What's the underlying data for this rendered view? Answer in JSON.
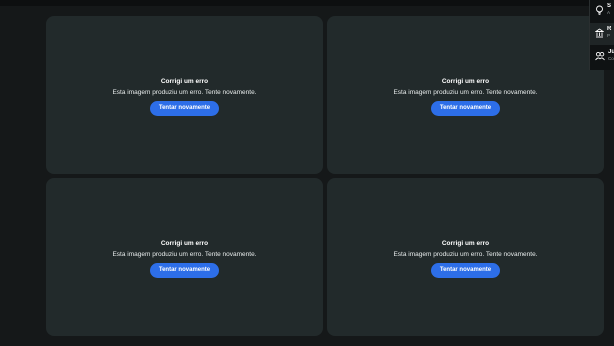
{
  "cards": [
    {
      "title": "Corrigi um erro",
      "message": "Esta imagem produziu um erro. Tente novamente.",
      "button": "Tentar novamente"
    },
    {
      "title": "Corrigi um erro",
      "message": "Esta imagem produziu um erro. Tente novamente.",
      "button": "Tentar novamente"
    },
    {
      "title": "Corrigi um erro",
      "message": "Esta imagem produziu um erro. Tente novamente.",
      "button": "Tentar novamente"
    },
    {
      "title": "Corrigi um erro",
      "message": "Esta imagem produziu um erro. Tente novamente.",
      "button": "Tentar novamente"
    }
  ],
  "side_panel": {
    "items": [
      {
        "icon": "lightbulb-icon",
        "title": "S",
        "sub": "A"
      },
      {
        "icon": "bank-icon",
        "title": "R",
        "sub": "P"
      },
      {
        "icon": "people-icon",
        "title": "Ju",
        "sub": "Co"
      }
    ]
  },
  "colors": {
    "background": "#151819",
    "card": "#222a2b",
    "button": "#2d6ee8"
  }
}
